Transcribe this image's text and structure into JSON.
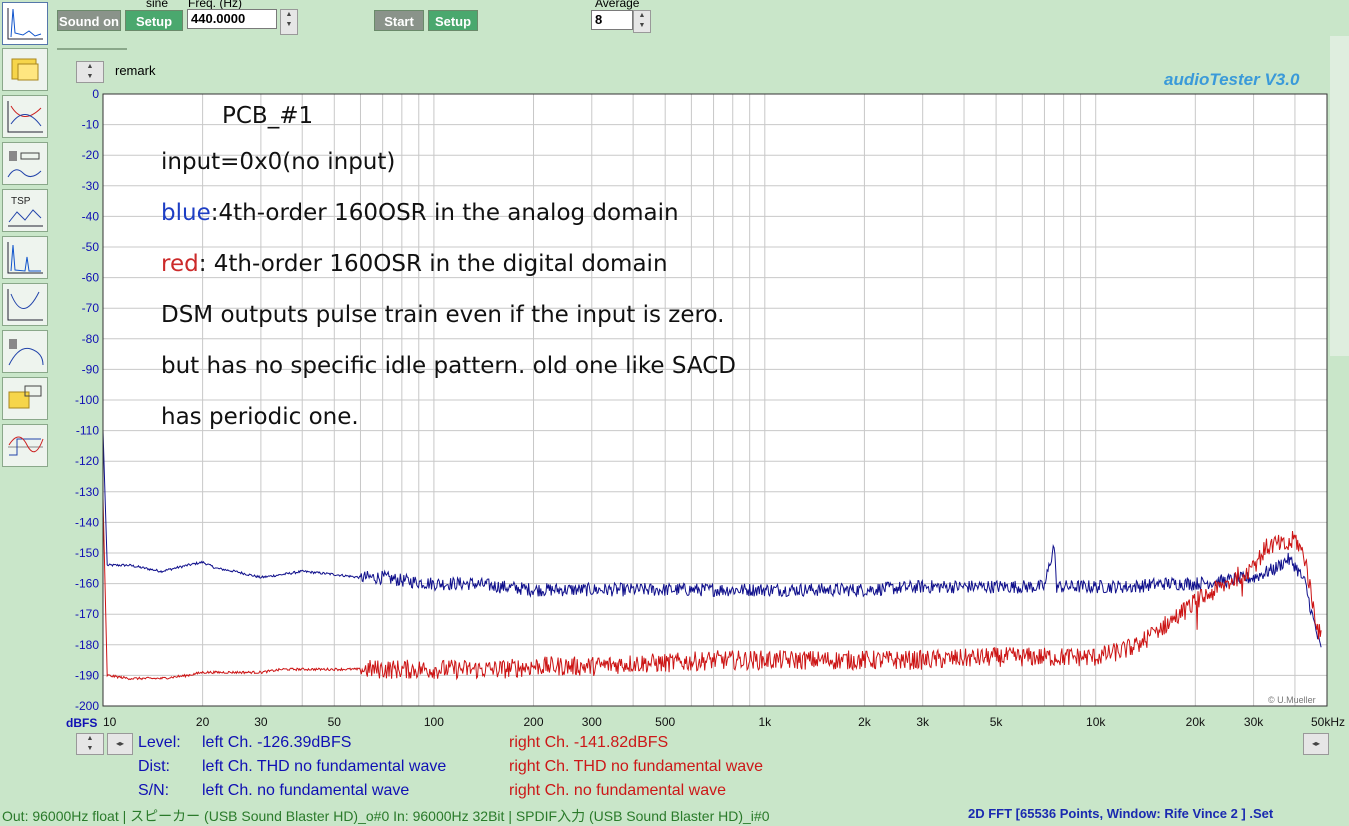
{
  "toolbar": {
    "sound_on": "Sound on",
    "setup1": "Setup",
    "sine_label": "sine",
    "freq_label": "Freq. (Hz)",
    "freq_value": "440.0000",
    "start": "Start",
    "setup2": "Setup",
    "average_label": "Average",
    "average_value": "8"
  },
  "remark_label": "remark",
  "brand": "audioTester  V3.0",
  "copyright": "© U.Mueller",
  "annotations": {
    "line1": "PCB_#1",
    "line2": "input=0x0(no input)",
    "line3_colored": "blue",
    "line3_rest": ":4th-order 160OSR in the analog domain",
    "line4_colored": "red",
    "line4_rest": ": 4th-order 160OSR in the digital domain",
    "line5": "DSM outputs pulse train even if the input is zero.",
    "line6": "but has no specific idle pattern. old one like SACD",
    "line7": "has periodic one."
  },
  "stats": {
    "level_label": "Level:",
    "level_left": "left Ch. -126.39dBFS",
    "level_right": "right Ch. -141.82dBFS",
    "dist_label": "Dist:",
    "dist_left": "left Ch. THD no fundamental wave",
    "dist_right": "right Ch. THD no fundamental wave",
    "sn_label": "S/N:",
    "sn_left": "left Ch.  no fundamental wave",
    "sn_right": "right Ch.  no fundamental wave"
  },
  "status": {
    "left": "Out: 96000Hz float  | スピーカー (USB Sound Blaster HD)_o#0  In: 96000Hz 32Bit  | SPDIF入力 (USB Sound Blaster HD)_i#0",
    "right": "2D FFT [65536 Points, Window: Rife Vince 2 ]  .Set"
  },
  "colors": {
    "blue_trace": "#10108c",
    "red_trace": "#cc1414",
    "grid": "#c8c8c8",
    "axis_text": "#1010b4"
  },
  "chart_data": {
    "type": "line",
    "xscale": "log",
    "xlim": [
      10,
      50000
    ],
    "ylim": [
      -200,
      0
    ],
    "ylabel": "dBFS",
    "xticks": [
      {
        "v": 10,
        "label": "10"
      },
      {
        "v": 20,
        "label": "20"
      },
      {
        "v": 30,
        "label": "30"
      },
      {
        "v": 50,
        "label": "50"
      },
      {
        "v": 100,
        "label": "100"
      },
      {
        "v": 200,
        "label": "200"
      },
      {
        "v": 300,
        "label": "300"
      },
      {
        "v": 500,
        "label": "500"
      },
      {
        "v": 1000,
        "label": "1k"
      },
      {
        "v": 2000,
        "label": "2k"
      },
      {
        "v": 3000,
        "label": "3k"
      },
      {
        "v": 5000,
        "label": "5k"
      },
      {
        "v": 10000,
        "label": "10k"
      },
      {
        "v": 20000,
        "label": "20k"
      },
      {
        "v": 30000,
        "label": "30k"
      },
      {
        "v": 50000,
        "label": "50kHz"
      }
    ],
    "yticks": [
      0,
      -10,
      -20,
      -30,
      -40,
      -50,
      -60,
      -70,
      -80,
      -90,
      -100,
      -110,
      -120,
      -130,
      -140,
      -150,
      -160,
      -170,
      -180,
      -190,
      -200
    ],
    "series": [
      {
        "color": "#10108c",
        "x": [
          10,
          10.3,
          12,
          15,
          18,
          20,
          22,
          25,
          30,
          35,
          40,
          50,
          60,
          70,
          80,
          100,
          130,
          160,
          200,
          250,
          300,
          400,
          500,
          700,
          1000,
          1500,
          2000,
          3000,
          5000,
          7000,
          7500,
          7600,
          8000,
          10000,
          13000,
          16000,
          20000,
          25000,
          30000,
          35000,
          38000,
          40000,
          43000,
          45000,
          47000,
          48000
        ],
        "y": [
          -110,
          -154,
          -154,
          -156,
          -154,
          -153,
          -155,
          -156,
          -158,
          -157,
          -156,
          -157,
          -158,
          -158,
          -159,
          -160,
          -160,
          -161,
          -162,
          -162,
          -162,
          -162,
          -162,
          -162,
          -162,
          -162,
          -162,
          -161,
          -161,
          -161,
          -147,
          -161,
          -161,
          -161,
          -161,
          -160,
          -160,
          -159,
          -158,
          -155,
          -152,
          -154,
          -160,
          -170,
          -178,
          -182
        ]
      },
      {
        "color": "#cc1414",
        "x": [
          10,
          10.3,
          12,
          15,
          18,
          20,
          22,
          25,
          30,
          35,
          40,
          50,
          60,
          70,
          80,
          100,
          130,
          160,
          200,
          250,
          300,
          400,
          500,
          700,
          1000,
          1500,
          2000,
          3000,
          5000,
          8000,
          10000,
          12000,
          13500,
          15000,
          17000,
          20000,
          25000,
          30000,
          33000,
          35000,
          38000,
          40000,
          43000,
          45000,
          47000,
          48000
        ],
        "y": [
          -132,
          -190,
          -191,
          -191,
          -190,
          -189,
          -189,
          -189,
          -189,
          -188,
          -188,
          -188,
          -188,
          -188,
          -188,
          -188,
          -188,
          -188,
          -187,
          -187,
          -187,
          -186,
          -186,
          -185,
          -185,
          -185,
          -185,
          -185,
          -184,
          -184,
          -184,
          -182,
          -180,
          -176,
          -172,
          -166,
          -160,
          -154,
          -148,
          -147,
          -148,
          -145,
          -152,
          -165,
          -175,
          -178
        ]
      }
    ]
  }
}
